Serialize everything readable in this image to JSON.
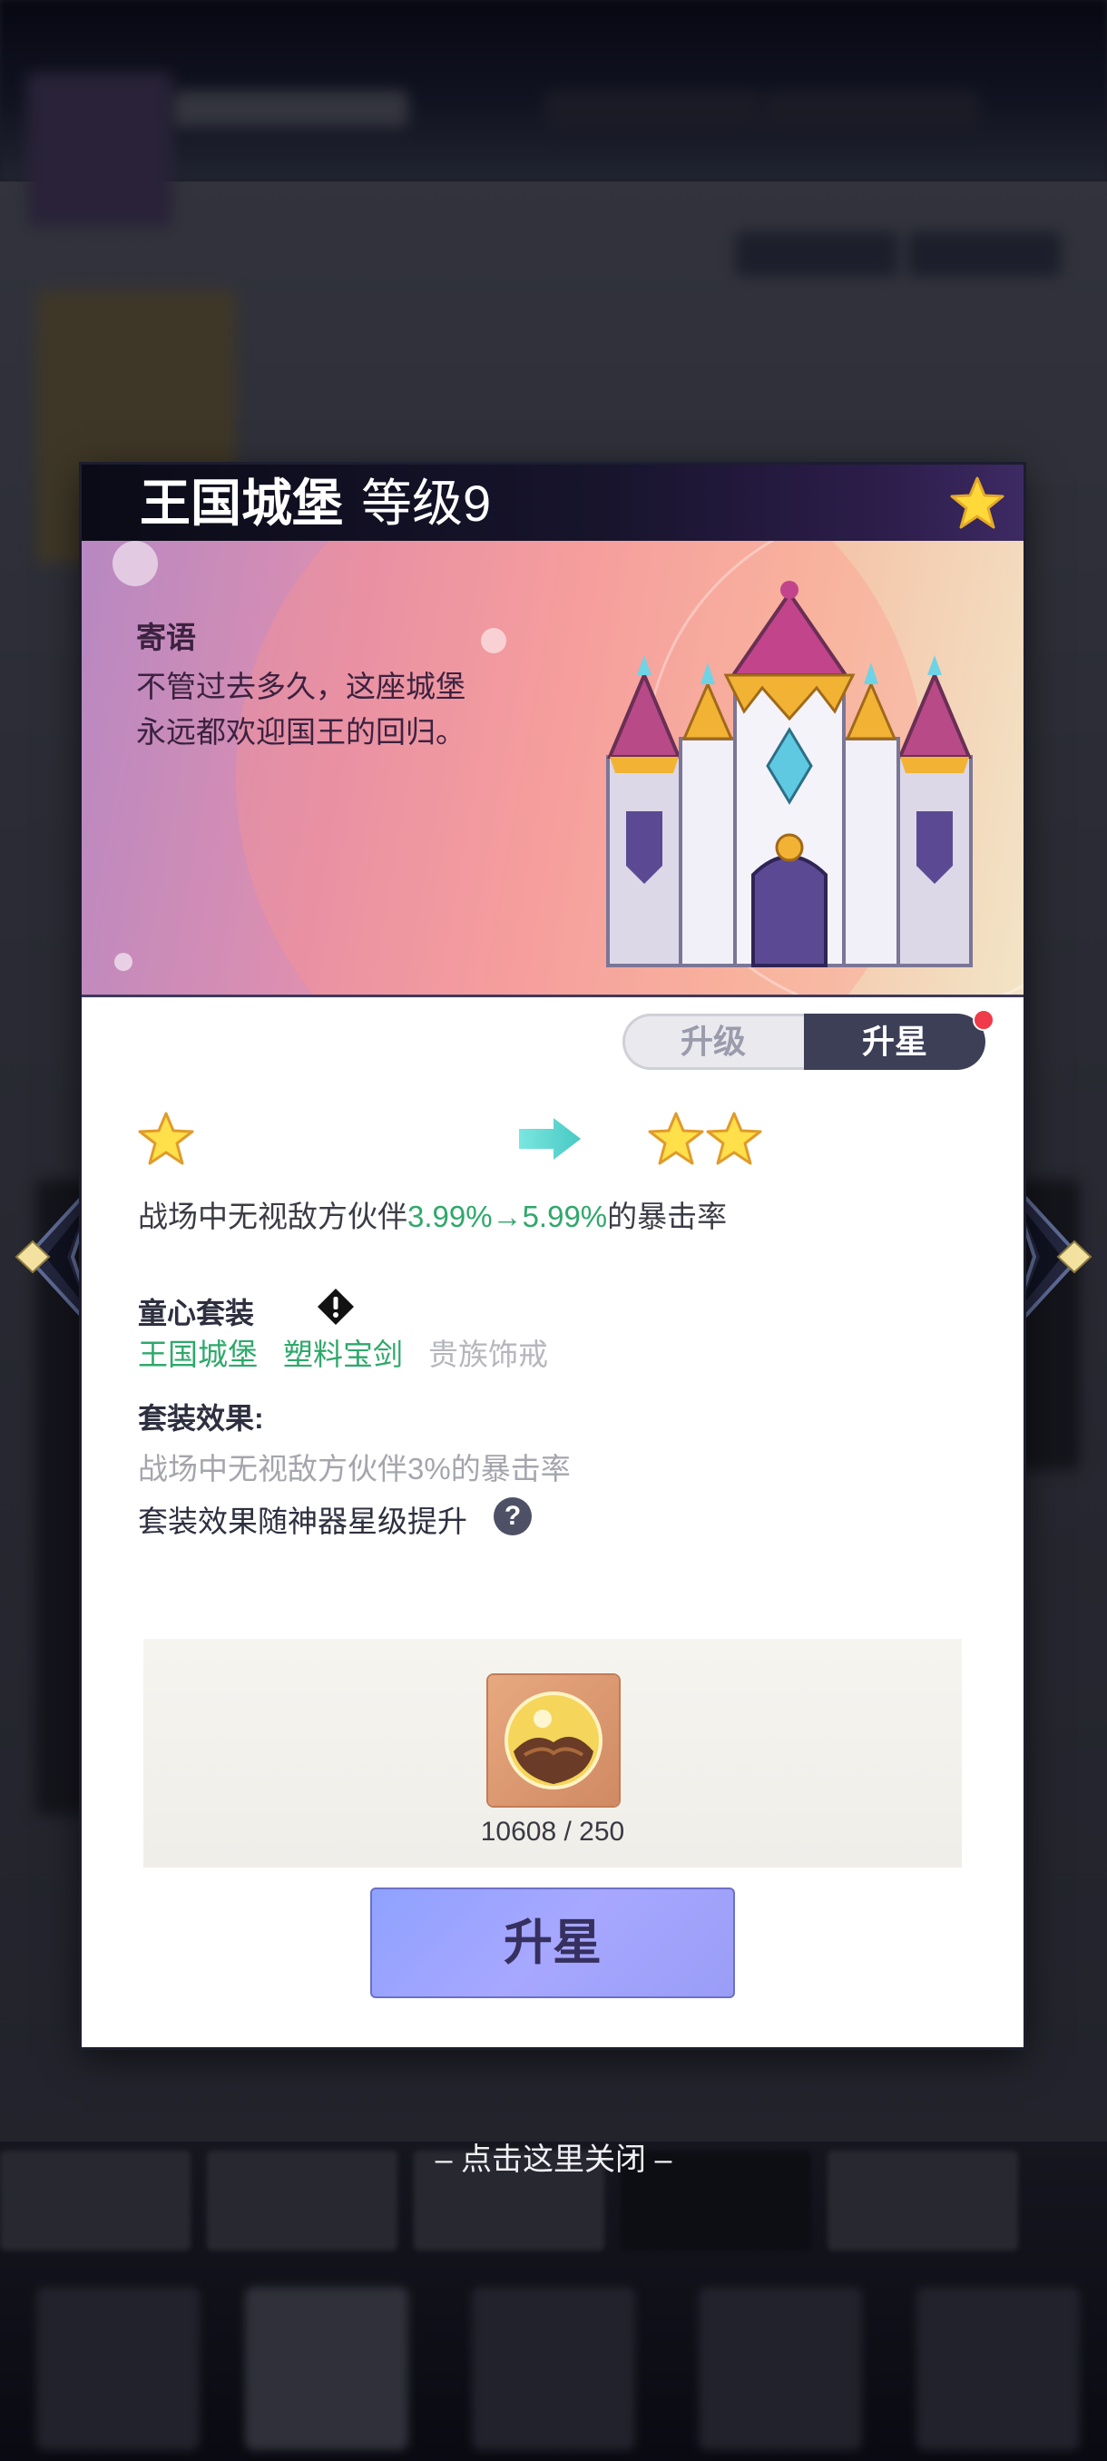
{
  "dialog": {
    "title": "王国城堡",
    "level": "等级9",
    "quote_title": "寄语",
    "quote_text": "不管过去多久，这座城堡永远都欢迎国王的回归。",
    "tabs": [
      "升级",
      "升星"
    ],
    "active_tab": "升星",
    "current_stars": 1,
    "next_stars": 2,
    "effect_prefix": "战场中无视敌方伙伴",
    "effect_from": "3.99%",
    "effect_arrow": "→",
    "effect_to": "5.99%",
    "effect_suffix": "的暴击率",
    "set_title": "童心套装",
    "set_items": [
      {
        "name": "王国城堡",
        "owned": true
      },
      {
        "name": "塑料宝剑",
        "owned": true
      },
      {
        "name": "贵族饰戒",
        "owned": false
      }
    ],
    "set_bonus_title": "套装效果:",
    "set_bonus_desc": "战场中无视敌方伙伴3%的暴击率",
    "set_bonus_note": "套装效果随神器星级提升",
    "cost_quantity": "10608 / 250",
    "upgrade_button": "升星"
  },
  "close_hint": "– 点击这里关闭 –",
  "colors": {
    "accent_green": "#2fa86b",
    "header_dark": "#0b0b17",
    "button_purple": "#9a9df6"
  }
}
